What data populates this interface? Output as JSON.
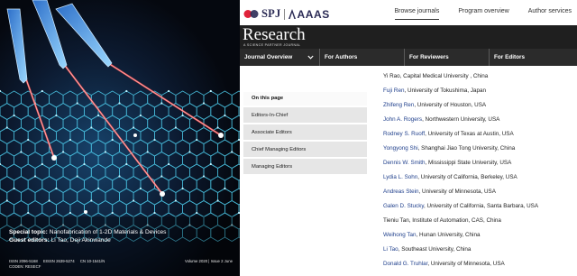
{
  "cover": {
    "topic_label": "Special topic:",
    "topic_text": "Nanofabrication of 1-2D Materials & Devices",
    "guest_label": "Guest editors:",
    "guest_text": "Li Tao, Deji Akinwande",
    "issn_print": "ISSN 2096-5168",
    "issn_online": "EISSN 2639-5274",
    "cn": "CN 10-1541/N",
    "coden": "CODEN: RESECF",
    "volume": "Volume 2020 | Issue 2 June",
    "colors": {
      "background": "#0a0f1c",
      "lattice": "#4fd0f0",
      "beam": "#ff5050"
    }
  },
  "publisher": {
    "spj": "SPJ",
    "aaas": "AAAS"
  },
  "topnav": {
    "browse": "Browse journals",
    "program": "Program overview",
    "author_services": "Author services",
    "active": "browse"
  },
  "journal": {
    "title": "Research",
    "tagline": "A SCIENCE PARTNER JOURNAL"
  },
  "secnav": {
    "items": [
      "Journal Overview",
      "For Authors",
      "For Reviewers",
      "For Editors"
    ],
    "chevron_icon": "chevron-down-icon"
  },
  "on_this_page": {
    "heading": "On this page",
    "items": [
      "Editors-In-Chief",
      "Associate Editors",
      "Chief Managing Editors",
      "Managing Editors"
    ]
  },
  "editors": [
    {
      "name": "Yi Rao",
      "affiliation": ", Capital Medical University , China",
      "linked": false
    },
    {
      "name": "Fuji Ren",
      "affiliation": ", University of Tokushima, Japan",
      "linked": true
    },
    {
      "name": "Zhifeng Ren",
      "affiliation": ", University of Houston, USA",
      "linked": true
    },
    {
      "name": "John A. Rogers",
      "affiliation": ", Northwestern University, USA",
      "linked": true
    },
    {
      "name": "Rodney S. Ruoff",
      "affiliation": ", University of Texas at Austin, USA",
      "linked": true
    },
    {
      "name": "Yongyong Shi",
      "affiliation": ", Shanghai Jiao Tong University, China",
      "linked": true
    },
    {
      "name": "Dennis W. Smith",
      "affiliation": ", Mississippi State University, USA",
      "linked": true
    },
    {
      "name": "Lydia L. Sohn",
      "affiliation": ", University of California, Berkeley, USA",
      "linked": true
    },
    {
      "name": "Andreas Stein",
      "affiliation": ", University of Minnesota, USA",
      "linked": true
    },
    {
      "name": "Galen D. Stucky",
      "affiliation": ", University of California, Santa Barbara, USA",
      "linked": true
    },
    {
      "name": "Tieniu Tan",
      "affiliation": ", Institute of Automation, CAS, China",
      "linked": false
    },
    {
      "name": "Weihong Tan",
      "affiliation": ", Hunan University, China",
      "linked": true
    },
    {
      "name": "Li Tao",
      "affiliation": ", Southeast University, China",
      "linked": true
    },
    {
      "name": "Donald G. Truhlar",
      "affiliation": ", University of Minnesota, USA",
      "linked": true
    }
  ]
}
